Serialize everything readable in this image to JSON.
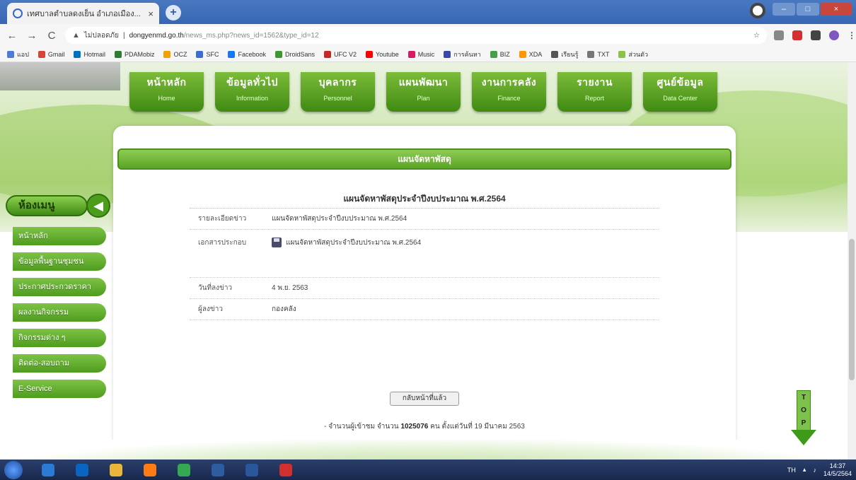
{
  "browser": {
    "tab_title": "เทศบาลตำบลดงเย็น อำเภอเมือง...",
    "tab_close": "×",
    "new_tab": "+",
    "url_warning": "ไม่ปลอดภัย",
    "url_host": "dongyenmd.go.th",
    "url_path": "/news_ms.php?news_id=1562&type_id=12",
    "nav": {
      "back": "←",
      "forward": "→",
      "reload": "C"
    },
    "window": {
      "minimize": "–",
      "maximize": "□",
      "close": "×"
    }
  },
  "bookmarks": [
    {
      "label": "แอป",
      "color": "#4a7dd6"
    },
    {
      "label": "Gmail",
      "color": "#d44638"
    },
    {
      "label": "Hotmail",
      "color": "#0072c6"
    },
    {
      "label": "PDAMobiz",
      "color": "#2e7d32"
    },
    {
      "label": "OCZ",
      "color": "#f4a100"
    },
    {
      "label": "SFC",
      "color": "#3a6ed1"
    },
    {
      "label": "Facebook",
      "color": "#1877f2"
    },
    {
      "label": "DroidSans",
      "color": "#3a9a2e"
    },
    {
      "label": "UFC V2",
      "color": "#c62828"
    },
    {
      "label": "Youtube",
      "color": "#ff0000"
    },
    {
      "label": "Music",
      "color": "#d81b60"
    },
    {
      "label": "การค้นหา",
      "color": "#3949ab"
    },
    {
      "label": "BIZ",
      "color": "#43a047"
    },
    {
      "label": "XDA",
      "color": "#ff9800"
    },
    {
      "label": "เรียนรู้",
      "color": "#555555"
    },
    {
      "label": "TXT",
      "color": "#777777"
    },
    {
      "label": "ส่วนตัว",
      "color": "#8bc34a"
    }
  ],
  "top_menu": [
    {
      "th": "หน้าหลัก",
      "en": "Home"
    },
    {
      "th": "ข้อมูลทั่วไป",
      "en": "Information"
    },
    {
      "th": "บุคลากร",
      "en": "Personnel"
    },
    {
      "th": "แผนพัฒนา",
      "en": "Plan"
    },
    {
      "th": "งานการคลัง",
      "en": "Finance"
    },
    {
      "th": "รายงาน",
      "en": "Report"
    },
    {
      "th": "ศูนย์ข้อมูล",
      "en": "Data Center"
    }
  ],
  "sidebar": {
    "title": "ห้องเมนู",
    "arrow": "◀",
    "items": [
      {
        "label": "หน้าหลัก"
      },
      {
        "label": "ข้อมูลพื้นฐานชุมชน"
      },
      {
        "label": "ประกาศประกวดราคา"
      },
      {
        "label": "ผลงานกิจกรรม"
      },
      {
        "label": "กิจกรรมต่าง ๆ"
      },
      {
        "label": "ติดต่อ-สอบถาม"
      },
      {
        "label": "E-Service"
      }
    ]
  },
  "section_header": "แผนจัดหาพัสดุ",
  "detail": {
    "title": "แผนจัดหาพัสดุประจำปีงบประมาณ พ.ศ.2564",
    "rows": [
      {
        "label": "รายละเอียดข่าว",
        "value": "แผนจัดหาพัสดุประจำปีงบประมาณ พ.ศ.2564"
      },
      {
        "label": "เอกสารประกอบ",
        "value": "แผนจัดหาพัสดุประจำปีงบประมาณ พ.ศ.2564"
      },
      {
        "label": "วันที่ลงข่าว",
        "value": "4 พ.ย. 2563"
      },
      {
        "label": "ผู้ลงข่าว",
        "value": "กองคลัง"
      }
    ],
    "back_button": "กลับหน้าที่แล้ว",
    "stats_prefix": "- จำนวนผู้เข้าชม จำนวน",
    "stats_count": "1025076",
    "stats_suffix": "คน ตั้งแต่วันที่ 19 มีนาคม 2563"
  },
  "top_button": {
    "letters": [
      "T",
      "O",
      "P"
    ]
  },
  "taskbar": {
    "apps": [
      {
        "name": "ie",
        "color": "#2b7bd6"
      },
      {
        "name": "outlook",
        "color": "#0a64c2"
      },
      {
        "name": "explorer",
        "color": "#e9b53a"
      },
      {
        "name": "firefox",
        "color": "#ff7b16"
      },
      {
        "name": "chrome",
        "color": "#34a853"
      },
      {
        "name": "photoshop",
        "color": "#2d5d9e"
      },
      {
        "name": "word",
        "color": "#2b579a"
      },
      {
        "name": "acrobat",
        "color": "#d32f2f"
      }
    ],
    "lang": "TH",
    "time": "14:37",
    "date": "14/5/2564"
  }
}
